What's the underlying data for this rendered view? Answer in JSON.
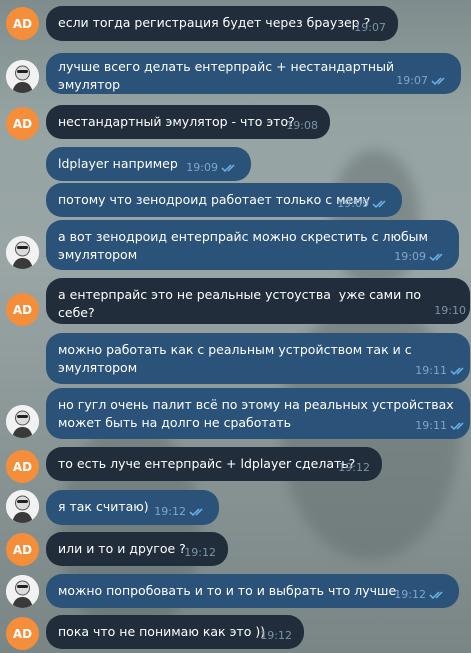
{
  "avatar_initials": "AD",
  "colors": {
    "incoming": "#212d3b",
    "outgoing": "#2b5278",
    "ad_avatar": "#f58e3a"
  },
  "messages": [
    {
      "text": "если тогда регистрация будет через браузер ?",
      "time": "19:07",
      "side": "in"
    },
    {
      "text": "лучше всего делать ентерпрайс + нестандартный эмулятор",
      "time": "19:07",
      "side": "out"
    },
    {
      "text": "нестандартный эмулятор - что это?",
      "time": "19:08",
      "side": "in"
    },
    {
      "text": "ldplayer например",
      "time": "19:09",
      "side": "out"
    },
    {
      "text": "потому что зенодроид работает только с мему",
      "time": "19:09",
      "side": "out"
    },
    {
      "text": "а вот зенодроид ентерпрайс можно скрестить с любым эмулятором",
      "time": "19:09",
      "side": "out"
    },
    {
      "text": "а ентерпрайс это не реальные устоуства  уже сами по себе?",
      "time": "19:10",
      "side": "in"
    },
    {
      "text": "можно работать как с реальным устройством так и с эмулятором",
      "time": "19:11",
      "side": "out"
    },
    {
      "text": "но гугл очень палит всё по этому на реальных устройствах может быть на долго не сработать",
      "time": "19:11",
      "side": "out"
    },
    {
      "text": "то есть луче ентерпрайс + ldplayer сделать?",
      "time": "19:12",
      "side": "in"
    },
    {
      "text": "я так считаю)",
      "time": "19:12",
      "side": "out"
    },
    {
      "text": "или и то и другое ?",
      "time": "19:12",
      "side": "in"
    },
    {
      "text": "можно попробовать и то и то и выбрать что лучше",
      "time": "19:12",
      "side": "out"
    },
    {
      "text": "пока что не понимаю как это ))",
      "time": "19:12",
      "side": "in"
    }
  ]
}
